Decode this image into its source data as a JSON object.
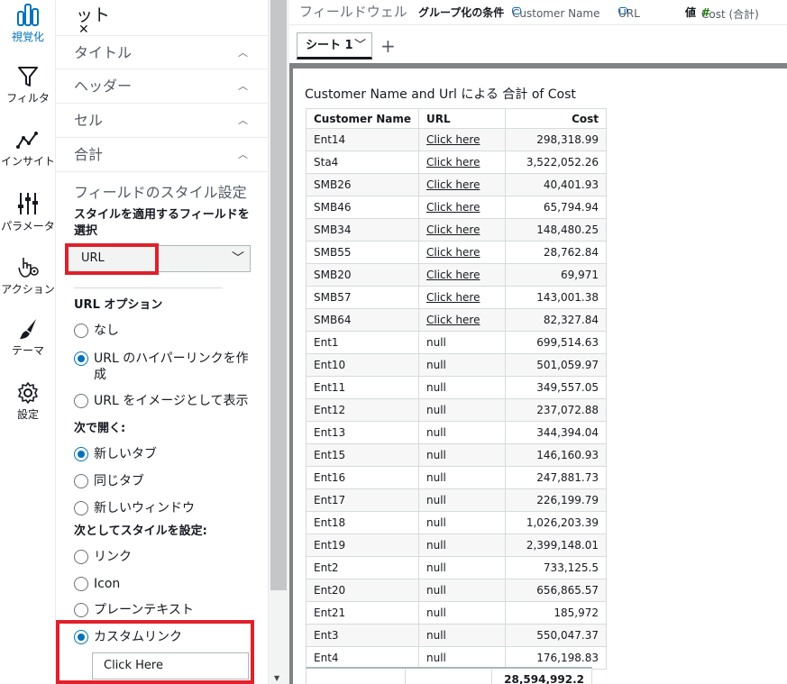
{
  "rail": {
    "items": [
      {
        "label": "視覚化",
        "icon": "bar-chart-icon",
        "active": true
      },
      {
        "label": "フィルタ",
        "icon": "filter-icon"
      },
      {
        "label": "インサイト",
        "icon": "insights-icon"
      },
      {
        "label": "パラメータ",
        "icon": "parameters-icon"
      },
      {
        "label": "アクション",
        "icon": "actions-icon"
      },
      {
        "label": "テーマ",
        "icon": "theme-icon"
      },
      {
        "label": "設定",
        "icon": "gear-icon"
      }
    ]
  },
  "panel": {
    "title": "ット",
    "close": "✕",
    "sections": [
      "タイトル",
      "ヘッダー",
      "セル",
      "合計"
    ],
    "field_styling_title": "フィールドのスタイル設定",
    "field_select_label": "スタイルを適用するフィールドを選択",
    "field_select_value": "URL",
    "url_options_label": "URL オプション",
    "url_options": [
      {
        "label": "なし",
        "checked": false
      },
      {
        "label": "URL のハイパーリンクを作成",
        "checked": true
      },
      {
        "label": "URL をイメージとして表示",
        "checked": false
      }
    ],
    "open_in_label": "次で開く:",
    "open_in_options": [
      {
        "label": "新しいタブ",
        "checked": true
      },
      {
        "label": "同じタブ",
        "checked": false
      },
      {
        "label": "新しいウィンドウ",
        "checked": false
      }
    ],
    "style_as_label": "次としてスタイルを設定:",
    "style_as_options": [
      {
        "label": "リンク",
        "checked": false
      },
      {
        "label": "Icon",
        "checked": false
      },
      {
        "label": "プレーンテキスト",
        "checked": false
      },
      {
        "label": "カスタムリンク",
        "checked": true
      }
    ],
    "custom_link_value": "Click Here"
  },
  "wells": {
    "title": "フィールドウェル",
    "group_by": "グループ化の条件",
    "group_fields": [
      "Customer Name",
      "URL"
    ],
    "value_label": "値",
    "value_field": "Cost (合計)"
  },
  "tabs": {
    "sheet": "シート 1",
    "add": "+"
  },
  "visual": {
    "title": "Customer Name and Url による 合計 of Cost",
    "headers": [
      "Customer Name",
      "URL",
      "Cost"
    ],
    "rows": [
      [
        "Ent14",
        "Click here",
        "298,318.99"
      ],
      [
        "Sta4",
        "Click here",
        "3,522,052.26"
      ],
      [
        "SMB26",
        "Click here",
        "40,401.93"
      ],
      [
        "SMB46",
        "Click here",
        "65,794.94"
      ],
      [
        "SMB34",
        "Click here",
        "148,480.25"
      ],
      [
        "SMB55",
        "Click here",
        "28,762.84"
      ],
      [
        "SMB20",
        "Click here",
        "69,971"
      ],
      [
        "SMB57",
        "Click here",
        "143,001.38"
      ],
      [
        "SMB64",
        "Click here",
        "82,327.84"
      ],
      [
        "Ent1",
        "null",
        "699,514.63"
      ],
      [
        "Ent10",
        "null",
        "501,059.97"
      ],
      [
        "Ent11",
        "null",
        "349,557.05"
      ],
      [
        "Ent12",
        "null",
        "237,072.88"
      ],
      [
        "Ent13",
        "null",
        "344,394.04"
      ],
      [
        "Ent15",
        "null",
        "146,160.93"
      ],
      [
        "Ent16",
        "null",
        "247,881.73"
      ],
      [
        "Ent17",
        "null",
        "226,199.79"
      ],
      [
        "Ent18",
        "null",
        "1,026,203.39"
      ],
      [
        "Ent19",
        "null",
        "2,399,148.01"
      ],
      [
        "Ent2",
        "null",
        "733,125.5"
      ],
      [
        "Ent20",
        "null",
        "656,865.57"
      ],
      [
        "Ent21",
        "null",
        "185,972"
      ],
      [
        "Ent3",
        "null",
        "550,047.37"
      ],
      [
        "Ent4",
        "null",
        "176,198.83"
      ]
    ],
    "total": "28,594,992.2"
  },
  "colors": {
    "accent": "#0073bb",
    "highlight": "#e0202a"
  }
}
